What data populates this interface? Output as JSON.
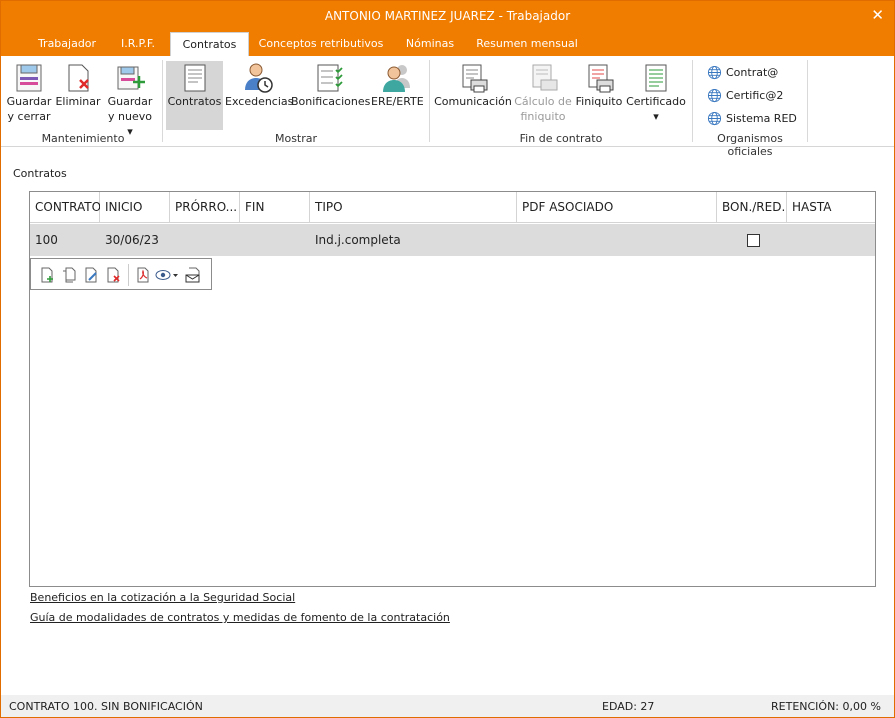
{
  "window": {
    "title": "ANTONIO MARTINEZ JUAREZ - Trabajador",
    "close_glyph": "✕"
  },
  "tabs": [
    {
      "label": "Trabajador"
    },
    {
      "label": "I.R.P.F."
    },
    {
      "label": "Contratos"
    },
    {
      "label": "Conceptos retributivos"
    },
    {
      "label": "Nóminas"
    },
    {
      "label": "Resumen mensual"
    }
  ],
  "ribbon": {
    "groups": {
      "mantenimiento": "Mantenimiento",
      "mostrar": "Mostrar",
      "fin_contrato": "Fin de contrato",
      "organismos": "Organismos oficiales"
    },
    "guardar_cerrar": [
      "Guardar",
      "y cerrar"
    ],
    "eliminar": "Eliminar",
    "guardar_nuevo": [
      "Guardar",
      "y nuevo ▾"
    ],
    "contratos": "Contratos",
    "excedencias": "Excedencias",
    "bonificaciones": "Bonificaciones",
    "ere_erte": "ERE/ERTE",
    "comunicacion": "Comunicación",
    "calculo_finiquito": [
      "Cálculo de",
      "finiquito"
    ],
    "finiquito": "Finiquito",
    "certificado": "Certificado",
    "certificado_arrow": "▾",
    "contrata": "Contrat@",
    "certifica2": "Certific@2",
    "sistema_red": "Sistema RED"
  },
  "section_label": "Contratos",
  "grid": {
    "headers": [
      "CONTRATO",
      "INICIO",
      "PRÓRRO...",
      "FIN",
      "TIPO",
      "PDF ASOCIADO",
      "BON./RED.",
      "HASTA"
    ],
    "rows": [
      {
        "contrato": "100",
        "inicio": "30/06/23",
        "prorroga": "",
        "fin": "",
        "tipo": "Ind.j.completa",
        "pdf": "",
        "bon_red": false,
        "hasta": ""
      }
    ]
  },
  "links": {
    "beneficios": "Beneficios en la cotización a la Seguridad Social",
    "guia": "Guía de modalidades de contratos y medidas de fomento de la contratación"
  },
  "status": {
    "left": "CONTRATO 100.  SIN BONIFICACIÓN",
    "edad": "EDAD: 27",
    "retencion": "RETENCIÓN: 0,00 %"
  },
  "colors": {
    "accent": "#f07c00",
    "selected_row": "#dcdcdc"
  }
}
